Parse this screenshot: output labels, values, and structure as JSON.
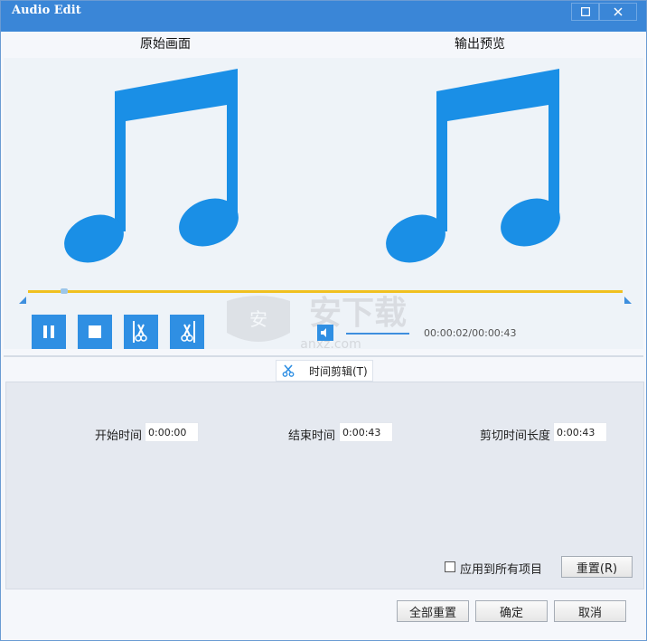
{
  "window": {
    "title": "Audio Edit",
    "maximize_icon": "maximize-icon",
    "close_icon": "close-icon"
  },
  "headers": {
    "original": "原始画面",
    "output": "输出预览"
  },
  "playback": {
    "time": "00:00:02/00:00:43",
    "icons": [
      "pause-icon",
      "stop-icon",
      "cut-start-icon",
      "cut-end-icon",
      "volume-icon"
    ]
  },
  "watermark": {
    "text": "安下载",
    "sub": "anxz.com"
  },
  "tab": {
    "label": "时间剪辑(T)",
    "icon": "scissors-icon"
  },
  "fields": {
    "start": {
      "label": "开始时间",
      "value": "0:00:00"
    },
    "end": {
      "label": "结束时间",
      "value": "0:00:43"
    },
    "length": {
      "label": "剪切时间长度",
      "value": "0:00:43"
    }
  },
  "options": {
    "apply_all": "应用到所有项目",
    "reset": "重置(R)"
  },
  "footer": {
    "reset_all": "全部重置",
    "ok": "确定",
    "cancel": "取消"
  },
  "colors": {
    "accent": "#2f8fe3",
    "title_bar": "#3a86d7",
    "timeline": "#f0c020",
    "note": "#1a8fe6"
  }
}
